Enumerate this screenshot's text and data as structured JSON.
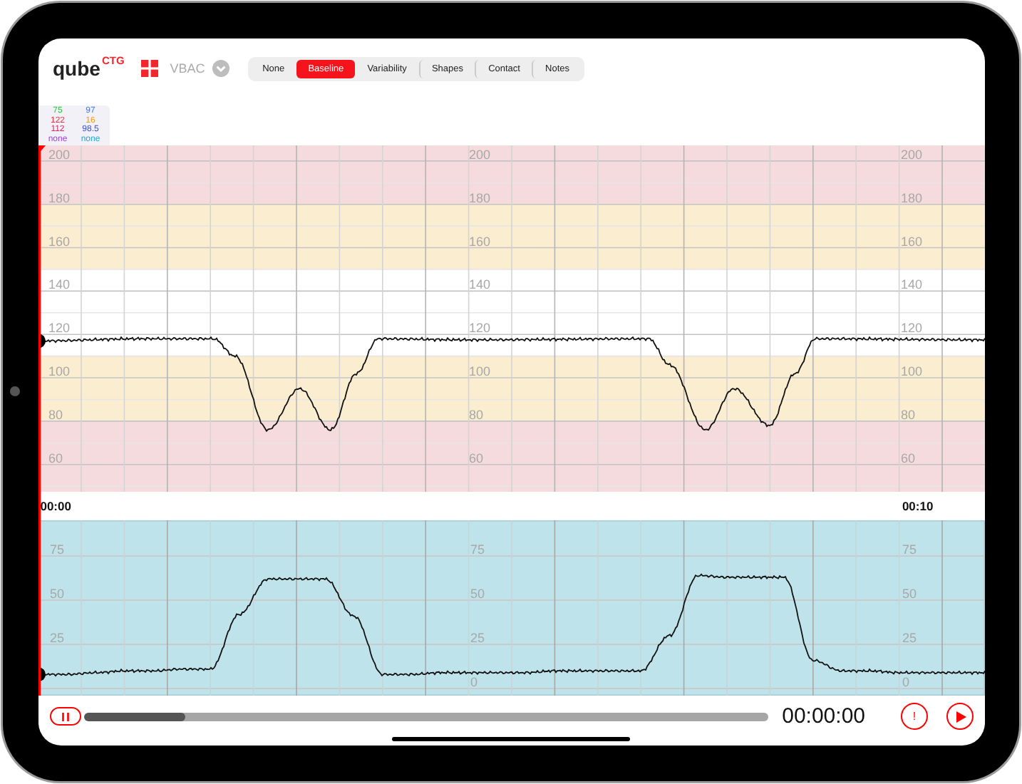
{
  "header": {
    "logo": {
      "name": "qube",
      "tag": "CTG"
    },
    "mode": "VBAC",
    "tabs": [
      {
        "label": "None",
        "selected": false
      },
      {
        "label": "Baseline",
        "selected": true
      },
      {
        "label": "Variability",
        "selected": false
      },
      {
        "label": "Shapes",
        "selected": false
      },
      {
        "label": "Contact",
        "selected": false
      },
      {
        "label": "Notes",
        "selected": false
      }
    ]
  },
  "readings": [
    {
      "text": "75",
      "color": "#2fc43a"
    },
    {
      "text": "97",
      "color": "#2d7cf6"
    },
    {
      "text": "122",
      "color": "#f2323a"
    },
    {
      "text": "16",
      "color": "#f39a12"
    },
    {
      "text": "112",
      "color": "#d8265e"
    },
    {
      "text": "98.5",
      "color": "#3a4fd8"
    },
    {
      "text": "none",
      "color": "#a43ee0"
    },
    {
      "text": "none",
      "color": "#22a8d8"
    }
  ],
  "fhr_chart": {
    "chart_data": {
      "type": "line",
      "grid": true,
      "ylim": [
        47.4,
        207.2
      ],
      "xlim": [
        -0.2,
        10.78
      ],
      "yticks": [
        200,
        180,
        160,
        140,
        120,
        100,
        80,
        60
      ],
      "xticks": [
        {
          "value": 0,
          "label": "00:00"
        },
        {
          "value": 10,
          "label": "00:10"
        }
      ],
      "x": [
        -0.2,
        1.01,
        1.83,
        2.08,
        2.46,
        2.83,
        3.19,
        3.49,
        3.74,
        4.81,
        6.88,
        7.12,
        7.54,
        7.87,
        8.28,
        8.58,
        8.81,
        10.78
      ],
      "series": [
        {
          "color": "#111111",
          "values": [
            117,
            118,
            118,
            110,
            76,
            95,
            76,
            102,
            118,
            117.5,
            118,
            106,
            76,
            95,
            78,
            102,
            118,
            117.5
          ]
        }
      ]
    },
    "axis_columns": [
      [
        "200",
        "180",
        "160",
        "140",
        "120",
        "100",
        "80",
        "60"
      ],
      [
        "200",
        "180",
        "160",
        "140",
        "120",
        "100",
        "80",
        "60"
      ],
      [
        "200",
        "180",
        "160",
        "140",
        "120",
        "100",
        "80",
        "60"
      ]
    ]
  },
  "ua_chart": {
    "chart_data": {
      "type": "line",
      "grid": true,
      "ylim": [
        -4,
        95.2
      ],
      "yticks": [
        75,
        50,
        25,
        0
      ],
      "series": [
        {
          "color": "#111111",
          "values": [
            8,
            8,
            9,
            10,
            10,
            11,
            11,
            42,
            62,
            62,
            62,
            41,
            8,
            8,
            9,
            9,
            9,
            9,
            10,
            10,
            10,
            10,
            30,
            64,
            63,
            63,
            63,
            16,
            10,
            10,
            9,
            9,
            9,
            9
          ]
        }
      ]
    },
    "axis_columns": [
      [
        "75",
        "50",
        "25"
      ],
      [
        "75",
        "50",
        "25",
        "0"
      ],
      [
        "75",
        "50",
        "25",
        "0"
      ]
    ]
  },
  "player": {
    "progress": {
      "level": 0.147
    },
    "time": "00:00:00",
    "alert_label": "!"
  }
}
